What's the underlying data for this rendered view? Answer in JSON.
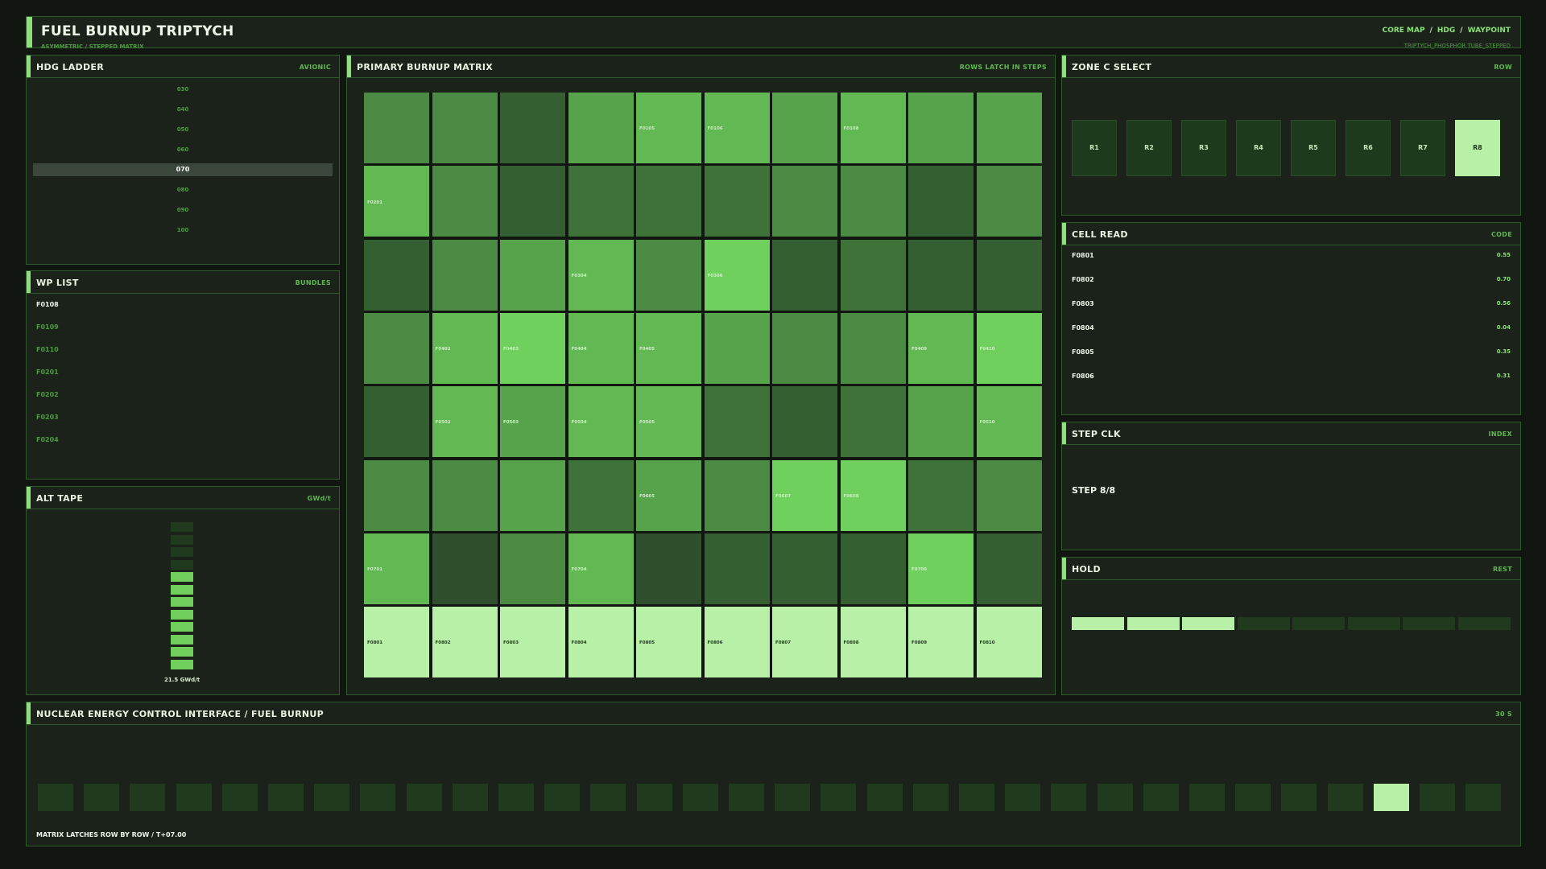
{
  "header": {
    "title": "FUEL BURNUP TRIPTYCH",
    "subtitle": "ASYMMETRIC / STEPPED MATRIX",
    "breadcrumb": [
      "CORE MAP",
      "HDG",
      "WAYPOINT"
    ],
    "note": "TRIPTYCH_PHOSPHOR TUBE_STEPPED"
  },
  "hdg_ladder": {
    "title": "HDG LADDER",
    "tag": "AVIONIC",
    "marks": [
      "030",
      "040",
      "050",
      "060",
      "070",
      "080",
      "090",
      "100"
    ],
    "current_index": 4
  },
  "wp_list": {
    "title": "WP LIST",
    "tag": "BUNDLES",
    "items": [
      "F0108",
      "F0109",
      "F0110",
      "F0201",
      "F0202",
      "F0203",
      "F0204"
    ],
    "active_index": 0
  },
  "alt_tape": {
    "title": "ALT TAPE",
    "tag": "GWd/t",
    "total_segments": 12,
    "lit_segments": 8,
    "value_label": "21.5 GWd/t"
  },
  "matrix": {
    "title": "PRIMARY  BURNUP MATRIX",
    "tag": "ROWS LATCH IN STEPS",
    "rows": [
      {
        "levels": [
          4,
          4,
          2,
          5,
          6,
          6,
          5,
          6,
          5,
          5
        ],
        "labels": [
          "",
          "",
          "",
          "",
          "F0105",
          "F0106",
          "",
          "F0108",
          "",
          ""
        ]
      },
      {
        "levels": [
          6,
          4,
          2,
          3,
          3,
          3,
          4,
          4,
          2,
          4
        ],
        "labels": [
          "F0201",
          "",
          "",
          "",
          "",
          "",
          "",
          "",
          "",
          ""
        ]
      },
      {
        "levels": [
          2,
          4,
          5,
          6,
          4,
          7,
          2,
          3,
          2,
          2
        ],
        "labels": [
          "",
          "",
          "",
          "F0304",
          "",
          "F0306",
          "",
          "",
          "",
          ""
        ]
      },
      {
        "levels": [
          4,
          6,
          7,
          6,
          6,
          5,
          4,
          4,
          6,
          7
        ],
        "labels": [
          "",
          "F0402",
          "F0403",
          "F0404",
          "F0405",
          "",
          "",
          "",
          "F0409",
          "F0410"
        ]
      },
      {
        "levels": [
          2,
          6,
          5,
          6,
          6,
          3,
          2,
          3,
          5,
          6
        ],
        "labels": [
          "",
          "F0502",
          "F0503",
          "F0504",
          "F0505",
          "",
          "",
          "",
          "",
          "F0510"
        ]
      },
      {
        "levels": [
          4,
          4,
          5,
          3,
          5,
          4,
          7,
          7,
          3,
          4
        ],
        "labels": [
          "",
          "",
          "",
          "",
          "F0605",
          "",
          "F0607",
          "F0608",
          "",
          ""
        ]
      },
      {
        "levels": [
          6,
          1,
          4,
          6,
          1,
          2,
          2,
          2,
          7,
          2
        ],
        "labels": [
          "F0701",
          "",
          "",
          "F0704",
          "",
          "",
          "",
          "",
          "F0709",
          ""
        ]
      },
      {
        "levels": [
          9,
          9,
          9,
          9,
          9,
          9,
          9,
          9,
          9,
          9
        ],
        "labels": [
          "F0801",
          "F0802",
          "F0803",
          "F0804",
          "F0805",
          "F0806",
          "F0807",
          "F0808",
          "F0809",
          "F0810"
        ]
      }
    ],
    "palette": {
      "1": "#2f4f2c",
      "2": "#345f30",
      "3": "#3e7238",
      "4": "#4a8a42",
      "5": "#56a34b",
      "6": "#62b852",
      "7": "#70d05e",
      "9": "#b8f0a8"
    }
  },
  "zone_select": {
    "title": "ZONE C  SELECT",
    "tag": "ROW",
    "buttons": [
      "R1",
      "R2",
      "R3",
      "R4",
      "R5",
      "R6",
      "R7",
      "R8"
    ],
    "active_index": 7
  },
  "cell_read": {
    "title": "CELL READ",
    "tag": "CODE",
    "rows": [
      {
        "key": "F0801",
        "value": "0.55"
      },
      {
        "key": "F0802",
        "value": "0.70"
      },
      {
        "key": "F0803",
        "value": "0.56"
      },
      {
        "key": "F0804",
        "value": "0.04"
      },
      {
        "key": "F0805",
        "value": "0.35"
      },
      {
        "key": "F0806",
        "value": "0.31"
      }
    ]
  },
  "step_clk": {
    "title": "STEP CLK",
    "tag": "INDEX",
    "text": "STEP 8/8"
  },
  "hold": {
    "title": "HOLD",
    "tag": "REST",
    "total_segments": 8,
    "lit_segments": 3
  },
  "bottom": {
    "title": "NUCLEAR ENERGY CONTROL INTERFACE  /  FUEL BURNUP",
    "tag": "30 S",
    "total_segments": 32,
    "active_index": 29,
    "footer": "MATRIX LATCHES ROW BY ROW  /  T+07.00"
  },
  "colors": {
    "accent": "#8ee07a",
    "accent_light": "#b8f0a8",
    "segment_dark": "#1f3a1c",
    "panel_bg": "#1b221a",
    "border": "#2f5a2c"
  }
}
